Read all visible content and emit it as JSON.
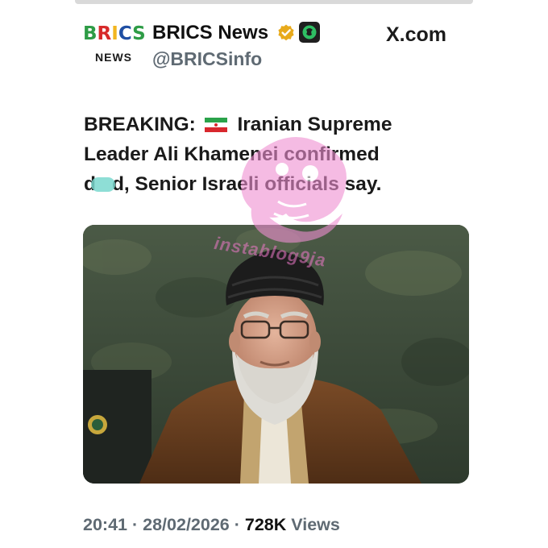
{
  "header": {
    "logo_top_text": "BRICS",
    "logo_bottom_text": "NEWS",
    "display_name": "BRICS News",
    "handle": "@BRICSinfo",
    "site_label": "X.com",
    "verified_badge_icon": "verified-gold-check-icon",
    "affiliate_badge_icon": "brics-affiliate-badge-icon"
  },
  "tweet": {
    "line1_prefix": "BREAKING:",
    "flag_icon": "iran-flag-icon",
    "line1_suffix": "Iranian Supreme",
    "line2": "Leader Ali Khamenei confirmed",
    "line3_start": "d",
    "line3_end": "d, Senior Israeli officials say."
  },
  "image": {
    "description_icon": "portrait-photo"
  },
  "watermark": {
    "text": "instablog9ja"
  },
  "meta": {
    "time": "20:41",
    "separator": "·",
    "date": "28/02/2026",
    "views_count": "728K",
    "views_label": "Views"
  },
  "colors": {
    "text": "#1a1a1a",
    "muted": "#5f6a73",
    "verified_gold": "#f2b51f",
    "watermark_pink": "#ec78c8",
    "blur_teal": "#7ad8cf"
  }
}
